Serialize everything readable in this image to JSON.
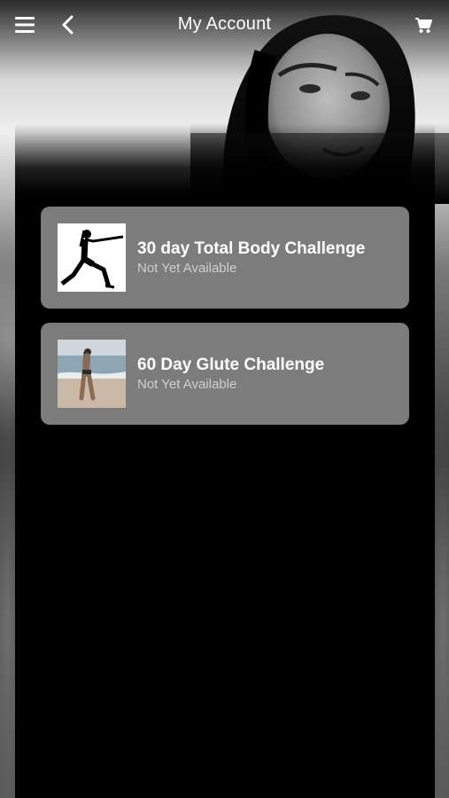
{
  "header": {
    "title": "My Account",
    "menu_icon": "hamburger-menu-icon",
    "back_icon": "chevron-left-icon",
    "cart_icon": "shopping-cart-icon"
  },
  "challenges": [
    {
      "title": "30 day Total Body Challenge",
      "status": "Not Yet Available",
      "thumbnail": "lunge-pose-photo"
    },
    {
      "title": "60 Day Glute Challenge",
      "status": "Not Yet Available",
      "thumbnail": "beach-photo"
    }
  ],
  "colors": {
    "card_background": "#7c7c7c",
    "panel_background": "#000000",
    "title_text": "#ffffff",
    "status_text": "#d0d0d0"
  }
}
